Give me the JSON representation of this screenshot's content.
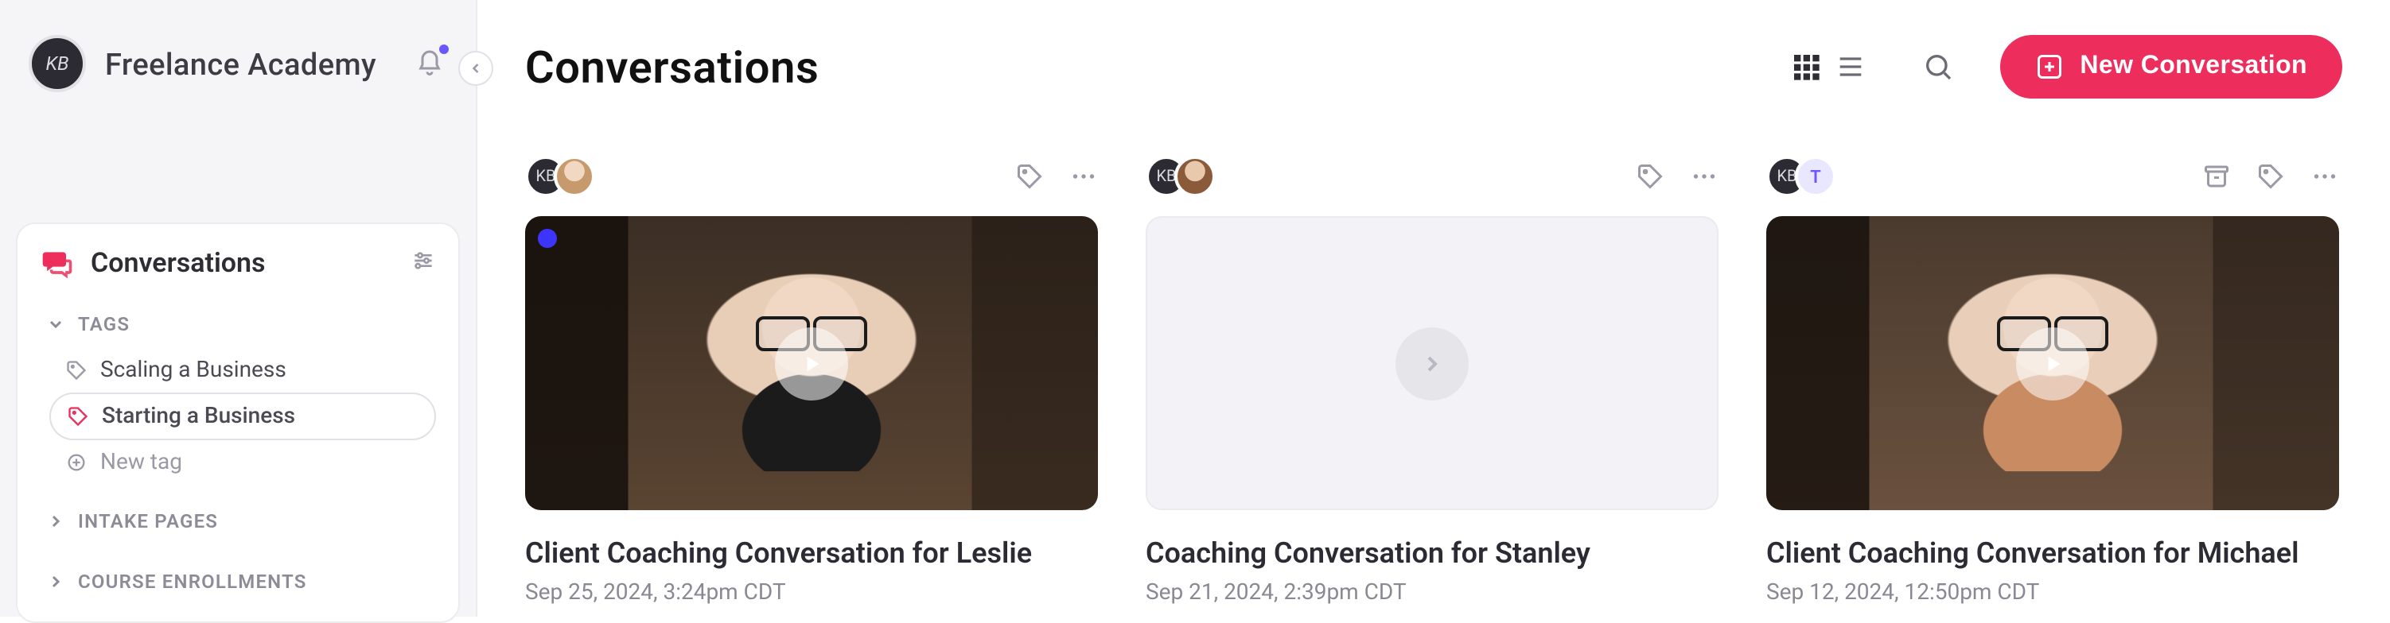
{
  "brand": {
    "name": "Freelance Academy",
    "logo_initials": "KB"
  },
  "sidebar": {
    "nav_title": "Conversations",
    "sections": {
      "tags": {
        "label": "TAGS",
        "items": [
          {
            "label": "Scaling a Business",
            "active": false
          },
          {
            "label": "Starting a Business",
            "active": true
          }
        ],
        "new_label": "New tag"
      },
      "intake": {
        "label": "INTAKE PAGES"
      },
      "enroll": {
        "label": "COURSE ENROLLMENTS"
      }
    }
  },
  "page": {
    "title": "Conversations",
    "new_button": "New Conversation"
  },
  "cards": [
    {
      "title": "Client Coaching Conversation for Leslie",
      "date": "Sep 25, 2024, 3:24pm CDT",
      "kind": "video",
      "unread": true,
      "second_avatar": "photo1",
      "second_letter": "",
      "extras": [
        "tag",
        "more"
      ]
    },
    {
      "title": "Coaching Conversation for Stanley",
      "date": "Sep 21, 2024, 2:39pm CDT",
      "kind": "placeholder",
      "unread": false,
      "second_avatar": "photo2",
      "second_letter": "",
      "extras": [
        "tag",
        "more"
      ]
    },
    {
      "title": "Client Coaching Conversation for Michael",
      "date": "Sep 12, 2024, 12:50pm CDT",
      "kind": "video2",
      "unread": false,
      "second_avatar": "letter",
      "second_letter": "T",
      "extras": [
        "archive",
        "tag",
        "more"
      ]
    }
  ]
}
